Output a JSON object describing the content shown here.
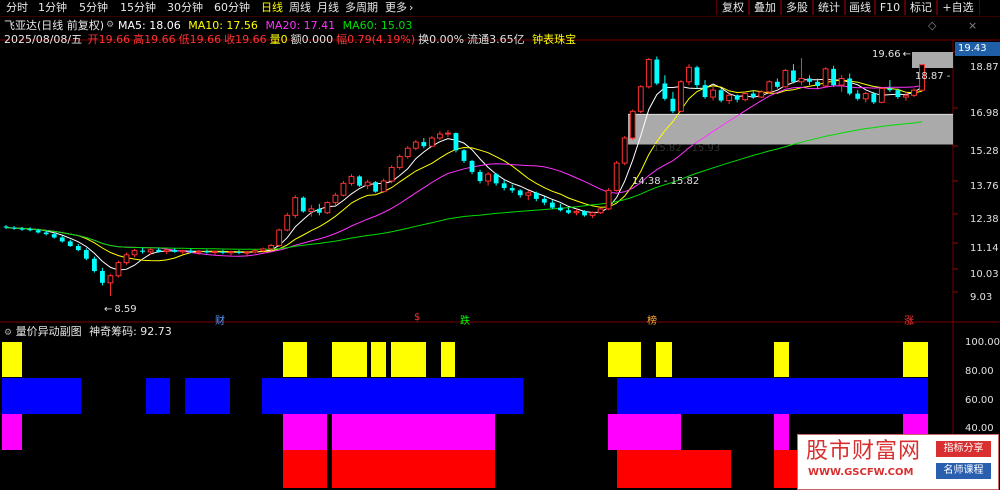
{
  "toolbar": {
    "periods": [
      "分时",
      "1分钟",
      "5分钟",
      "15分钟",
      "30分钟",
      "60分钟",
      "日线",
      "周线",
      "月线",
      "多周期",
      "更多"
    ],
    "active_period": "日线",
    "right_buttons": [
      "复权",
      "叠加",
      "多股",
      "统计",
      "画线",
      "F10",
      "标记",
      "+自选"
    ]
  },
  "header": {
    "title": "飞亚达(日线 前复权)",
    "ma": [
      {
        "label": "MA5: 18.06",
        "color": "#ffffff"
      },
      {
        "label": "MA10: 17.56",
        "color": "#ffff00"
      },
      {
        "label": "MA20: 17.41",
        "color": "#ff33ff"
      },
      {
        "label": "MA60: 15.03",
        "color": "#00dd00"
      }
    ],
    "date": "2025/08/08/五",
    "quote": [
      {
        "label": "开",
        "value": "19.66",
        "color": "#ff3333"
      },
      {
        "label": "高",
        "value": "19.66",
        "color": "#ff3333"
      },
      {
        "label": "低",
        "value": "19.66",
        "color": "#ff3333"
      },
      {
        "label": "收",
        "value": "19.66",
        "color": "#ff3333"
      },
      {
        "label": "量",
        "value": "0",
        "color": "#ffff00"
      },
      {
        "label": "额",
        "value": "0.000",
        "color": "#e0e0e0"
      },
      {
        "label": "幅",
        "value": "0.79(4.19%)",
        "color": "#ff3333"
      },
      {
        "label": "换",
        "value": "0.00%",
        "color": "#e0e0e0"
      },
      {
        "label": "流通",
        "value": "3.65亿",
        "color": "#e0e0e0"
      }
    ],
    "extra": "钟表珠宝",
    "extra_color": "#ffff00"
  },
  "price_axis": [
    "18.87",
    "16.98",
    "15.28",
    "13.76",
    "12.38",
    "11.14",
    "10.03",
    "9.03"
  ],
  "price_top": "19.43",
  "labels": {
    "high_mark": "19.66",
    "high_arrow": "←",
    "last_mark": "18.87 -",
    "low_mark": "8.59",
    "low_arrow": "←",
    "zone1": "15.82 - 15.93",
    "zone2": "14.38 - 15.82"
  },
  "events": [
    {
      "text": "财",
      "color": "#5599ff"
    },
    {
      "text": "$",
      "color": "#ff3333"
    },
    {
      "text": "跌",
      "color": "#00ff00"
    },
    {
      "text": "榜",
      "color": "#ffaa33"
    },
    {
      "text": "涨",
      "color": "#ff3333"
    }
  ],
  "indicator": {
    "title": "量价异动副图",
    "value_label": "神奇筹码: 92.73",
    "axis": [
      "100.00",
      "80.00",
      "60.00",
      "40.00"
    ]
  },
  "watermark": {
    "cn": "股市财富网",
    "url": "WWW.GSCFW.COM",
    "tag1": "指标分享",
    "tag2": "名师课程"
  },
  "chart_data": {
    "type": "candlestick",
    "ylim": [
      8.3,
      19.7
    ],
    "candles": [
      [
        10.88,
        10.93,
        10.78,
        10.84
      ],
      [
        10.84,
        10.9,
        10.76,
        10.8
      ],
      [
        10.8,
        10.86,
        10.72,
        10.78
      ],
      [
        10.78,
        10.85,
        10.7,
        10.74
      ],
      [
        10.74,
        10.8,
        10.62,
        10.66
      ],
      [
        10.66,
        10.72,
        10.55,
        10.6
      ],
      [
        10.6,
        10.65,
        10.44,
        10.48
      ],
      [
        10.48,
        10.54,
        10.3,
        10.34
      ],
      [
        10.34,
        10.4,
        10.15,
        10.18
      ],
      [
        10.18,
        10.25,
        10.0,
        10.04
      ],
      [
        10.04,
        10.1,
        9.7,
        9.75
      ],
      [
        9.75,
        9.82,
        9.3,
        9.35
      ],
      [
        9.35,
        9.45,
        8.9,
        8.98
      ],
      [
        8.98,
        9.25,
        8.59,
        9.2
      ],
      [
        9.2,
        9.68,
        9.15,
        9.62
      ],
      [
        9.62,
        9.95,
        9.55,
        9.88
      ],
      [
        9.88,
        10.08,
        9.8,
        10.02
      ],
      [
        10.02,
        10.12,
        9.92,
        9.98
      ],
      [
        9.98,
        10.1,
        9.88,
        10.05
      ],
      [
        10.05,
        10.12,
        9.95,
        9.99
      ],
      [
        9.99,
        10.08,
        9.9,
        10.04
      ],
      [
        10.04,
        10.1,
        9.95,
        9.98
      ],
      [
        9.98,
        10.05,
        9.9,
        10.02
      ],
      [
        10.02,
        10.08,
        9.94,
        9.97
      ],
      [
        9.97,
        10.04,
        9.88,
        10.0
      ],
      [
        10.0,
        10.06,
        9.92,
        9.96
      ],
      [
        9.96,
        10.02,
        9.88,
        9.99
      ],
      [
        9.99,
        10.05,
        9.9,
        9.95
      ],
      [
        9.95,
        10.02,
        9.86,
        9.98
      ],
      [
        9.98,
        10.04,
        9.9,
        9.95
      ],
      [
        9.95,
        10.0,
        9.85,
        9.97
      ],
      [
        9.97,
        10.06,
        9.92,
        10.02
      ],
      [
        10.02,
        10.12,
        9.96,
        10.08
      ],
      [
        10.08,
        10.25,
        10.02,
        10.2
      ],
      [
        10.2,
        10.8,
        10.15,
        10.75
      ],
      [
        10.75,
        11.4,
        10.7,
        11.3
      ],
      [
        11.3,
        12.1,
        11.2,
        12.0
      ],
      [
        12.0,
        12.05,
        11.4,
        11.45
      ],
      [
        11.45,
        11.7,
        11.25,
        11.55
      ],
      [
        11.55,
        11.75,
        11.3,
        11.4
      ],
      [
        11.4,
        11.85,
        11.35,
        11.8
      ],
      [
        11.8,
        12.2,
        11.7,
        12.1
      ],
      [
        12.1,
        12.7,
        12.05,
        12.6
      ],
      [
        12.6,
        13.0,
        12.5,
        12.9
      ],
      [
        12.9,
        12.95,
        12.45,
        12.5
      ],
      [
        12.5,
        12.75,
        12.35,
        12.65
      ],
      [
        12.65,
        12.7,
        12.2,
        12.25
      ],
      [
        12.25,
        12.8,
        12.2,
        12.7
      ],
      [
        12.7,
        13.4,
        12.6,
        13.3
      ],
      [
        13.3,
        13.9,
        13.2,
        13.8
      ],
      [
        13.8,
        14.3,
        13.7,
        14.2
      ],
      [
        14.2,
        14.6,
        14.1,
        14.5
      ],
      [
        14.5,
        14.7,
        14.2,
        14.3
      ],
      [
        14.3,
        14.8,
        14.25,
        14.7
      ],
      [
        14.7,
        15.05,
        14.6,
        14.9
      ],
      [
        14.9,
        15.1,
        14.75,
        14.95
      ],
      [
        14.95,
        14.98,
        14.0,
        14.1
      ],
      [
        14.1,
        14.15,
        13.5,
        13.6
      ],
      [
        13.6,
        13.65,
        13.0,
        13.1
      ],
      [
        13.1,
        13.2,
        12.6,
        12.7
      ],
      [
        12.7,
        13.1,
        12.5,
        13.0
      ],
      [
        13.0,
        13.05,
        12.5,
        12.6
      ],
      [
        12.6,
        12.75,
        12.3,
        12.4
      ],
      [
        12.4,
        12.55,
        12.2,
        12.3
      ],
      [
        12.3,
        12.35,
        12.0,
        12.1
      ],
      [
        12.1,
        12.3,
        11.9,
        12.2
      ],
      [
        12.2,
        12.25,
        11.85,
        11.95
      ],
      [
        11.95,
        12.05,
        11.7,
        11.8
      ],
      [
        11.8,
        11.9,
        11.55,
        11.6
      ],
      [
        11.6,
        11.75,
        11.45,
        11.5
      ],
      [
        11.5,
        11.6,
        11.35,
        11.4
      ],
      [
        11.4,
        11.55,
        11.3,
        11.45
      ],
      [
        11.45,
        11.5,
        11.25,
        11.3
      ],
      [
        11.3,
        11.45,
        11.2,
        11.4
      ],
      [
        11.4,
        11.6,
        11.35,
        11.55
      ],
      [
        11.55,
        12.4,
        11.5,
        12.3
      ],
      [
        12.3,
        13.6,
        12.25,
        13.5
      ],
      [
        13.5,
        14.8,
        13.4,
        14.7
      ],
      [
        14.7,
        16.2,
        14.6,
        16.1
      ],
      [
        16.1,
        17.6,
        16.0,
        17.5
      ],
      [
        17.5,
        19.3,
        17.4,
        19.2
      ],
      [
        19.2,
        19.4,
        17.6,
        17.7
      ],
      [
        17.7,
        18.2,
        16.7,
        16.8
      ],
      [
        16.8,
        17.2,
        16.0,
        16.1
      ],
      [
        16.1,
        17.9,
        16.05,
        17.8
      ],
      [
        17.8,
        18.9,
        17.6,
        18.7
      ],
      [
        18.7,
        18.8,
        17.4,
        17.6
      ],
      [
        17.6,
        17.9,
        16.8,
        16.9
      ],
      [
        16.9,
        17.5,
        16.7,
        17.3
      ],
      [
        17.3,
        17.4,
        16.6,
        16.7
      ],
      [
        16.7,
        17.1,
        16.5,
        17.0
      ],
      [
        17.0,
        17.05,
        16.6,
        16.75
      ],
      [
        16.75,
        17.2,
        16.65,
        17.1
      ],
      [
        17.1,
        17.3,
        16.8,
        16.9
      ],
      [
        16.9,
        17.3,
        16.85,
        17.2
      ],
      [
        17.2,
        17.9,
        17.1,
        17.8
      ],
      [
        17.8,
        18.0,
        17.4,
        17.5
      ],
      [
        17.5,
        18.6,
        17.45,
        18.5
      ],
      [
        18.5,
        18.9,
        17.7,
        17.8
      ],
      [
        17.8,
        19.3,
        17.6,
        18.0
      ],
      [
        18.0,
        18.2,
        17.6,
        17.8
      ],
      [
        17.8,
        18.0,
        17.4,
        17.55
      ],
      [
        17.55,
        18.7,
        17.5,
        18.6
      ],
      [
        18.6,
        18.8,
        17.5,
        17.6
      ],
      [
        17.6,
        18.2,
        17.2,
        18.0
      ],
      [
        18.0,
        18.3,
        17.0,
        17.1
      ],
      [
        17.1,
        17.3,
        16.7,
        16.8
      ],
      [
        16.8,
        17.2,
        16.6,
        17.1
      ],
      [
        17.1,
        17.2,
        16.5,
        16.6
      ],
      [
        16.6,
        17.5,
        16.55,
        17.4
      ],
      [
        17.4,
        17.9,
        17.2,
        17.3
      ],
      [
        17.3,
        17.4,
        16.8,
        16.9
      ],
      [
        16.9,
        17.2,
        16.7,
        17.0
      ],
      [
        17.0,
        17.4,
        16.9,
        17.3
      ],
      [
        17.3,
        18.87,
        17.2,
        18.87
      ]
    ]
  }
}
